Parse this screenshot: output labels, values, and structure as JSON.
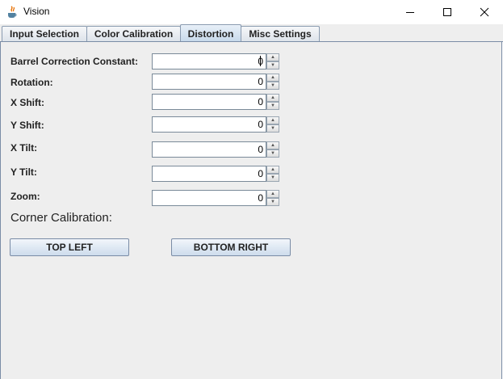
{
  "window": {
    "title": "Vision",
    "controls": [
      "minimize-icon",
      "maximize-icon",
      "close-icon"
    ]
  },
  "tabs": [
    {
      "label": "Input Selection",
      "active": false
    },
    {
      "label": "Color Calibration",
      "active": false
    },
    {
      "label": "Distortion",
      "active": true
    },
    {
      "label": "Misc Settings",
      "active": false
    }
  ],
  "fields": [
    {
      "label": "Barrel Correction Constant:",
      "value": "0"
    },
    {
      "label": "Rotation:",
      "value": "0"
    },
    {
      "label": "X Shift:",
      "value": "0"
    },
    {
      "label": "Y Shift:",
      "value": "0"
    },
    {
      "label": "X Tilt:",
      "value": "0"
    },
    {
      "label": "Y Tilt:",
      "value": "0"
    },
    {
      "label": "Zoom:",
      "value": "0"
    }
  ],
  "corner_calibration": {
    "title": "Corner Calibration:",
    "top_left_label": "TOP LEFT",
    "bottom_right_label": "BOTTOM RIGHT"
  },
  "colors": {
    "background": "#eeeeee",
    "tab_border": "#7a8ca6",
    "button_gradient_top": "#f2f6fb",
    "button_gradient_bottom": "#cddcec"
  }
}
